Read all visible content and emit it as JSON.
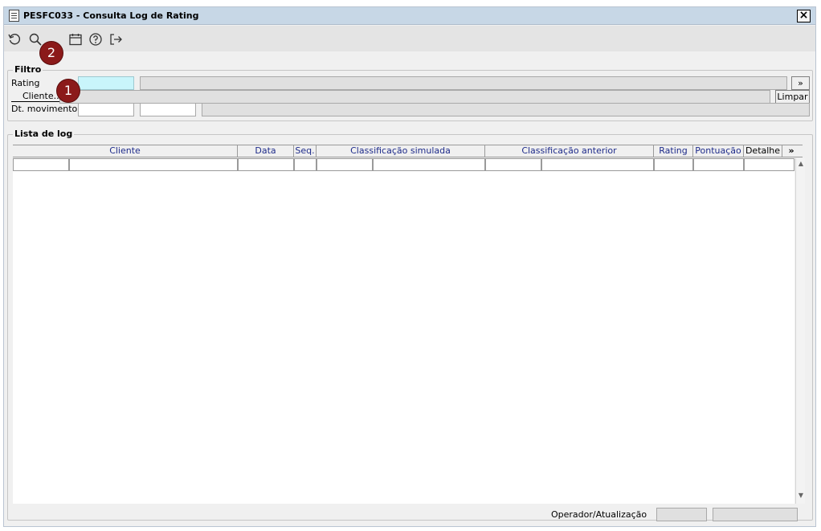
{
  "window": {
    "title": "PESFC033 - Consulta Log de Rating",
    "close_glyph": "×"
  },
  "toolbar": {
    "icons": [
      "refresh-icon",
      "search-icon",
      "calendar-icon",
      "help-icon",
      "exit-icon"
    ]
  },
  "markers": [
    "1",
    "2"
  ],
  "filter": {
    "legend": "Filtro",
    "rating_label": "Rating",
    "rating_value": "",
    "rating_desc": "",
    "expand_label": "»",
    "cliente_label": "Cliente...",
    "cliente_value": "",
    "clear_label": "Limpar",
    "dt_label": "Dt. movimento",
    "dt_from": "",
    "dt_to": "",
    "dt_desc": ""
  },
  "log": {
    "legend": "Lista de log",
    "columns": [
      "Cliente",
      "Data",
      "Seq.",
      "Classificação simulada",
      "Classificação anterior",
      "Rating",
      "Pontuação",
      "Detalhe",
      "»"
    ],
    "rows": [],
    "footer_label": "Operador/Atualização",
    "footer_operator": "",
    "footer_update": ""
  },
  "colors": {
    "titlebar": "#c7d7e6",
    "header_text": "#1e2b8a",
    "highlight_field": "#c9f5fb",
    "marker": "#8b1a1a"
  }
}
